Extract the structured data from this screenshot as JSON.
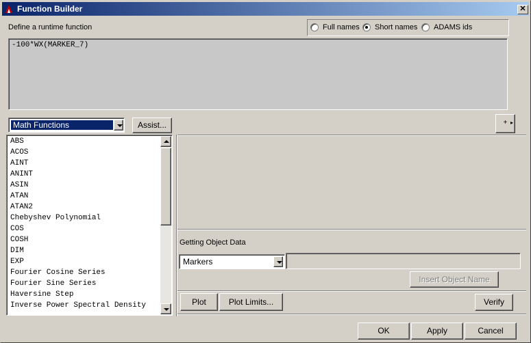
{
  "window": {
    "title": "Function Builder",
    "close_glyph": "✕"
  },
  "define_label": "Define a runtime function",
  "name_options": [
    {
      "label": "Full names",
      "checked": false
    },
    {
      "label": "Short names",
      "checked": true
    },
    {
      "label": "ADAMS ids",
      "checked": false
    }
  ],
  "function_text": "-100*WX(MARKER_7)",
  "category_select": {
    "value": "Math Functions"
  },
  "assist_label": "Assist...",
  "expand_glyph": "+",
  "functions": [
    "ABS",
    "ACOS",
    "AINT",
    "ANINT",
    "ASIN",
    "ATAN",
    "ATAN2",
    "Chebyshev Polynomial",
    "COS",
    "COSH",
    "DIM",
    "EXP",
    "Fourier Cosine Series",
    "Fourier Sine Series",
    "Haversine Step",
    "Inverse Power Spectral Density"
  ],
  "object_data": {
    "label": "Getting Object Data",
    "select_value": "Markers",
    "field_value": "",
    "insert_label": "Insert Object Name"
  },
  "plot_label": "Plot",
  "plot_limits_label": "Plot Limits...",
  "verify_label": "Verify",
  "ok_label": "OK",
  "apply_label": "Apply",
  "cancel_label": "Cancel",
  "colors": {
    "title_bar": "#0a246a",
    "selection": "#0a246a",
    "face": "#d4d0c8"
  }
}
